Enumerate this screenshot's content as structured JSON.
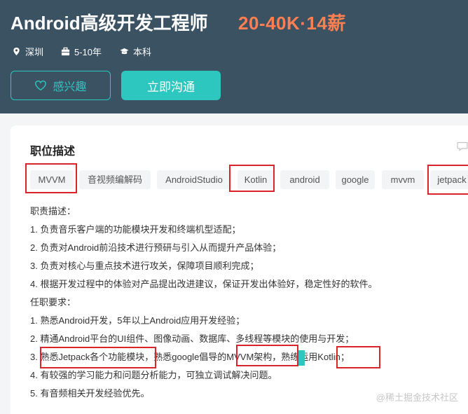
{
  "header": {
    "job_title": "Android高级开发工程师",
    "salary": "20-40K·14薪",
    "location": "深圳",
    "experience": "5-10年",
    "education": "本科",
    "like_label": "感兴趣",
    "chat_label": "立即沟通"
  },
  "section": {
    "title": "职位描述"
  },
  "tags": [
    "MVVM",
    "音视频编解码",
    "AndroidStudio",
    "Kotlin",
    "android",
    "google",
    "mvvm",
    "jetpack"
  ],
  "description": [
    "职责描述：",
    "1. 负责音乐客户端的功能模块开发和终端机型适配；",
    "2. 负责对Android前沿技术进行预研与引入从而提升产品体验；",
    "3. 负责对核心与重点技术进行攻关，保障项目顺利完成；",
    "4. 根据开发过程中的体验对产品提出改进建议，保证开发出体验好，稳定性好的软件。",
    "任职要求：",
    "1. 熟悉Android开发，5年以上Android应用开发经验；",
    "2. 精通Android平台的UI组件、图像动画、数据库、多线程等模块的使用与开发；",
    "3. 熟悉Jetpack各个功能模块，熟悉google倡导的MVVM架构，熟练运用Kotlin；",
    "4. 有较强的学习能力和问题分析能力，可独立调试解决问题。",
    "5. 有音频相关开发经验优先。"
  ],
  "icons": {
    "location": "location-pin-icon",
    "experience": "briefcase-icon",
    "education": "graduation-cap-icon",
    "like": "heart-icon",
    "comment": "comment-icon"
  },
  "colors": {
    "header_bg": "#3b5263",
    "accent": "#2ec7c0",
    "salary": "#ff7f50",
    "highlight_box": "#d9242b"
  },
  "watermark": "@稀土掘金技术社区"
}
